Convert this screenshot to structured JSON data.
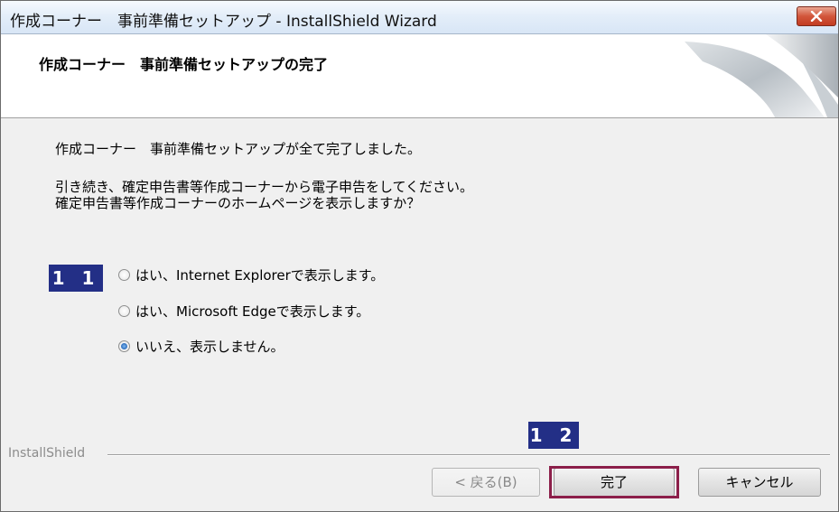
{
  "window": {
    "title": "作成コーナー　事前準備セットアップ - InstallShield Wizard",
    "close_icon": "close-icon"
  },
  "header": {
    "title": "作成コーナー　事前準備セットアップの完了"
  },
  "body": {
    "line1": "作成コーナー　事前準備セットアップが全て完了しました。",
    "line2": "引き続き、確定申告書等作成コーナーから電子申告をしてください。",
    "line3": "確定申告書等作成コーナーのホームページを表示しますか？"
  },
  "options": [
    {
      "label": "はい、Internet Explorerで表示します。",
      "selected": false
    },
    {
      "label": "はい、Microsoft Edgeで表示します。",
      "selected": false
    },
    {
      "label": "いいえ、表示しません。",
      "selected": true
    }
  ],
  "markers": {
    "m11": "1 1",
    "m12": "1 2"
  },
  "brand": "InstallShield",
  "buttons": {
    "back": "< 戻る(B)",
    "finish": "完了",
    "cancel": "キャンセル"
  },
  "colors": {
    "marker_bg": "#232f86",
    "highlight_border": "#8c1f4a",
    "close_button": "#c84a2f"
  }
}
